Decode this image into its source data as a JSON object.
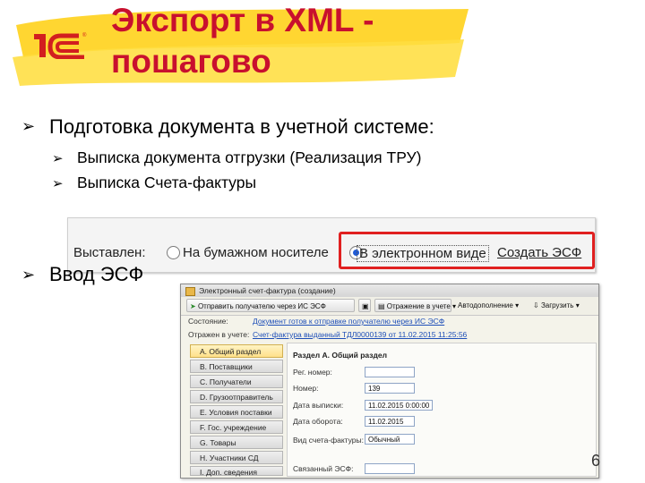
{
  "slide": {
    "title": "Экспорт в XML -\nпошагово",
    "bullets": [
      {
        "text": "Подготовка документа в учетной системе:"
      },
      {
        "text": "Ввод ЭСФ"
      }
    ],
    "sub_bullets": [
      {
        "text": "Выписка документа отгрузки (Реализация ТРУ)"
      },
      {
        "text": "Выписка Счета-фактуры"
      }
    ],
    "page_number": "6"
  },
  "issued_strip": {
    "label": "Выставлен:",
    "option_paper": "На бумажном носителе",
    "option_electronic": "В электронном виде",
    "selected": "В электронном виде",
    "create_link": "Создать ЭСФ"
  },
  "esf_window": {
    "title": "Электронный счет-фактура (создание)",
    "toolbar": {
      "send": "Отправить получателю через ИС ЭСФ",
      "reflection": "Отражение в учете",
      "actions": "Автодополнение",
      "tools": "Загрузить"
    },
    "state_label": "Состояние:",
    "state_value": "Документ готов к отправке получателю через ИС ЭСФ",
    "reflected_label": "Отражен в учете:",
    "reflected_value": "Счет-фактура выданный ТДЛ0000139 от 11.02.2015 11:25:56",
    "sections": [
      "А. Общий раздел",
      "B. Поставщики",
      "C. Получатели",
      "D. Грузоотправитель",
      "E. Условия поставки",
      "F. Гос. учреждение",
      "G. Товары",
      "H. Участники СД",
      "I. Доп. сведения"
    ],
    "selected_section": "А. Общий раздел",
    "panel_title": "Раздел А. Общий раздел",
    "fields": [
      {
        "label": "Рег. номер:",
        "value": ""
      },
      {
        "label": "Номер:",
        "value": "139"
      },
      {
        "label": "Дата выписки:",
        "value": "11.02.2015 0:00:00"
      },
      {
        "label": "Дата оборота:",
        "value": "11.02.2015"
      },
      {
        "label": "Вид счета-фактуры:",
        "value": "Обычный"
      },
      {
        "label": "Связанный ЭСФ:",
        "value": ""
      }
    ]
  }
}
